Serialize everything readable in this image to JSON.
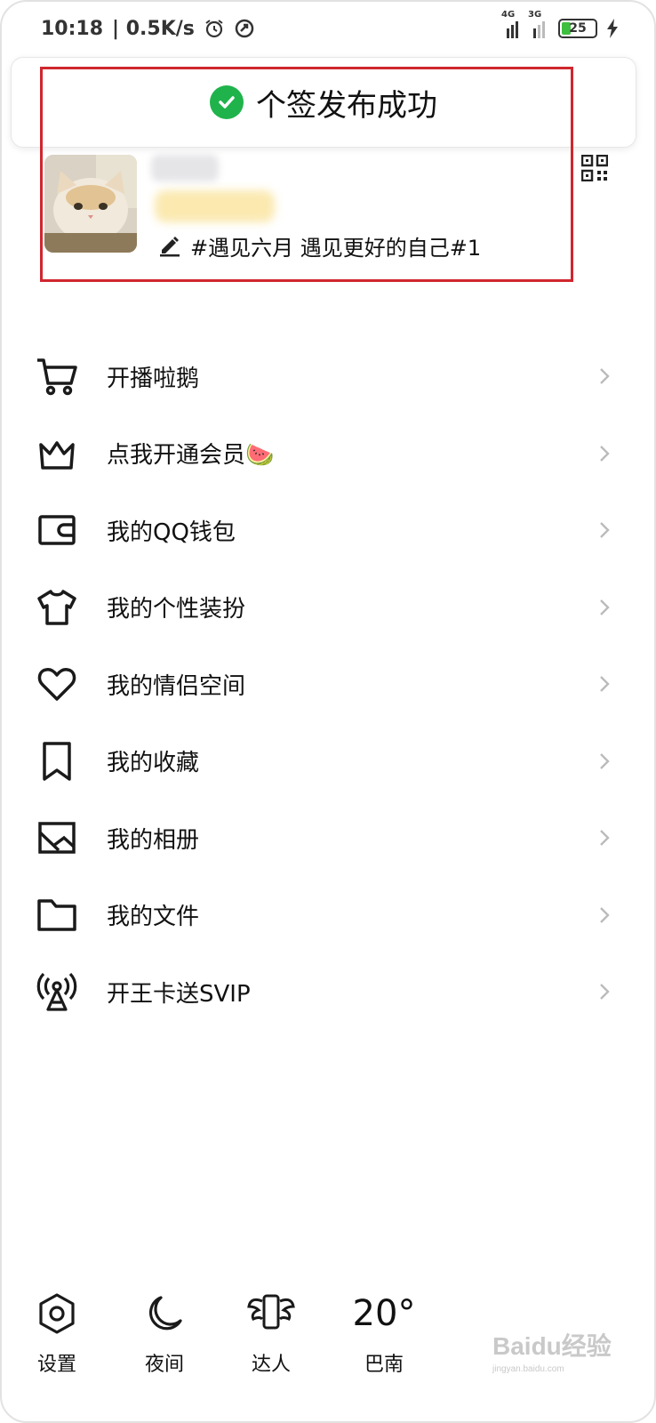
{
  "status_bar": {
    "time": "10:18",
    "net_speed": "| 0.5K/s",
    "sim1": "4G",
    "sim2": "3G",
    "battery": "25"
  },
  "toast": {
    "message": "个签发布成功",
    "icon": "check-circle-icon",
    "color": "#20b34c"
  },
  "profile": {
    "signature": "#遇见六月 遇见更好的自己#1",
    "avatar": "cat-photo",
    "qr_icon": "qr-code-icon"
  },
  "menu": {
    "items": [
      {
        "label": "开播啦鹅",
        "icon": "cart-icon"
      },
      {
        "label": "点我开通会员🍉",
        "icon": "crown-icon"
      },
      {
        "label": "我的QQ钱包",
        "icon": "wallet-icon"
      },
      {
        "label": "我的个性装扮",
        "icon": "tshirt-icon"
      },
      {
        "label": "我的情侣空间",
        "icon": "heart-icon"
      },
      {
        "label": "我的收藏",
        "icon": "bookmark-icon"
      },
      {
        "label": "我的相册",
        "icon": "album-icon"
      },
      {
        "label": "我的文件",
        "icon": "folder-icon"
      },
      {
        "label": "开王卡送SVIP",
        "icon": "signal-tower-icon"
      }
    ]
  },
  "bottom_bar": {
    "settings": "设置",
    "night": "夜间",
    "expert": "达人",
    "temperature": "20°",
    "city": "巴南"
  },
  "watermark": {
    "text": "Baidu经验",
    "sub": "jingyan.baidu.com"
  },
  "colors": {
    "accent_red": "#d0262e",
    "success_green": "#20b34c"
  }
}
